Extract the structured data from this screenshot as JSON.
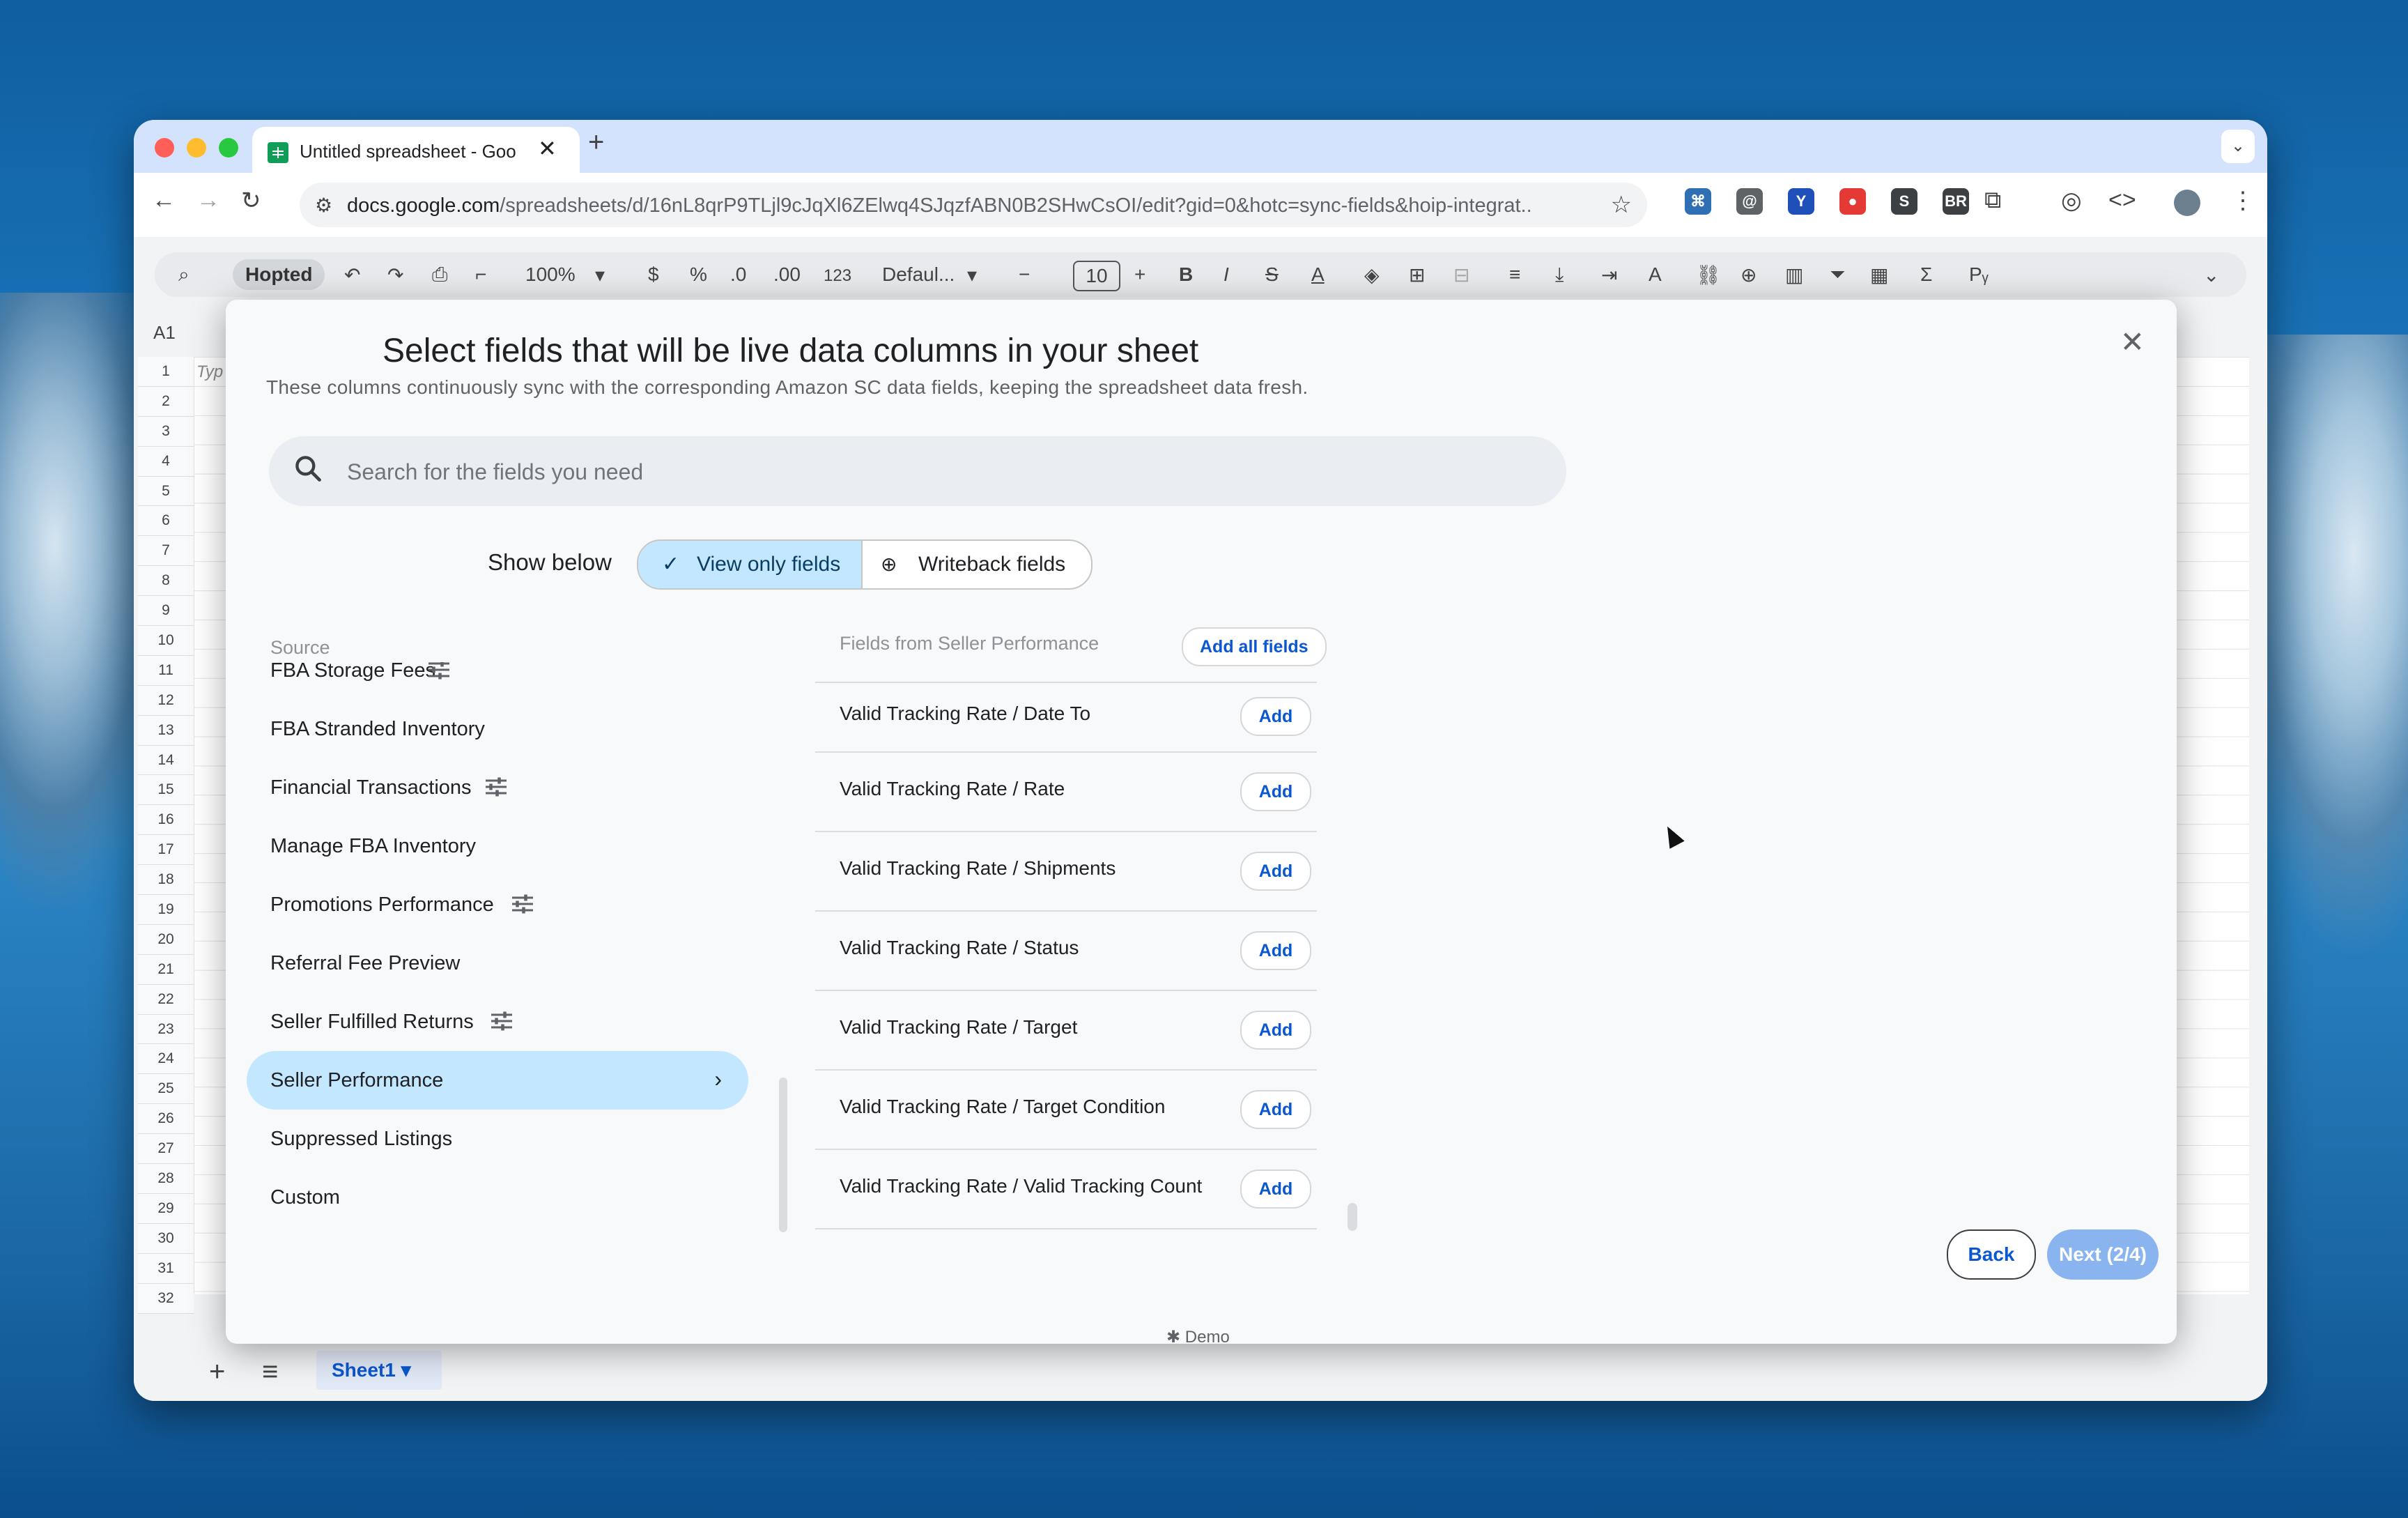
{
  "browser": {
    "tab_title": "Untitled spreadsheet - Googl",
    "tab_close": "✕",
    "new_tab": "+",
    "url_host": "docs.google.com",
    "url_path": "/spreadsheets/d/16nL8qrP9TLjl9cJqXl6ZElwq4SJqzfABN0B2SHwCsOI/edit?gid=0&hotc=sync-fields&hoip-integrat...",
    "extensions": [
      {
        "name": "ext-1",
        "label": "⌘",
        "color": "#2f6fb3"
      },
      {
        "name": "ext-2",
        "label": "@",
        "color": "#5f6368"
      },
      {
        "name": "ext-3",
        "label": "Y",
        "color": "#1f4fb8"
      },
      {
        "name": "ext-4",
        "label": "●",
        "color": "#e53935"
      },
      {
        "name": "ext-5",
        "label": "S",
        "color": "#3c4043"
      },
      {
        "name": "ext-6",
        "label": "BR",
        "color": "#3c4043"
      }
    ]
  },
  "sheets": {
    "toolbar": {
      "hopted": "Hopted",
      "zoom": "100%",
      "currency": "$",
      "percent": "%",
      "dec_less": ".0",
      "dec_more": ".00",
      "number_format": "123",
      "font": "Defaul...",
      "font_size": "10",
      "bold": "B",
      "italic": "I",
      "sigma": "Σ"
    },
    "name_box": "A1",
    "cell_a1": "Typ",
    "row_numbers": [
      "1",
      "2",
      "3",
      "4",
      "5",
      "6",
      "7",
      "8",
      "9",
      "10",
      "11",
      "12",
      "13",
      "14",
      "15",
      "16",
      "17",
      "18",
      "19",
      "20",
      "21",
      "22",
      "23",
      "24",
      "25",
      "26",
      "27",
      "28",
      "29",
      "30",
      "31",
      "32"
    ],
    "sheet_tab": "Sheet1"
  },
  "modal": {
    "title": "Select fields that will be live data columns in your sheet",
    "subtitle": "These columns continuously sync with the corresponding Amazon SC data fields, keeping the spreadsheet data fresh.",
    "search_placeholder": "Search for the fields you need",
    "show_below_label": "Show below",
    "view_only_label": "View only fields",
    "writeback_label": "Writeback fields",
    "source_header": "Source",
    "fields_header": "Fields from Seller Performance",
    "add_all_label": "Add all fields",
    "sources": [
      {
        "label": "FBA Storage Fees",
        "tune": true
      },
      {
        "label": "FBA Stranded Inventory",
        "tune": false
      },
      {
        "label": "Financial Transactions",
        "tune": true
      },
      {
        "label": "Manage FBA Inventory",
        "tune": false
      },
      {
        "label": "Promotions Performance",
        "tune": true
      },
      {
        "label": "Referral Fee Preview",
        "tune": false
      },
      {
        "label": "Seller Fulfilled Returns",
        "tune": true
      },
      {
        "label": "Seller Performance",
        "tune": false,
        "active": true
      },
      {
        "label": "Suppressed Listings",
        "tune": false
      },
      {
        "label": "Custom",
        "tune": false
      }
    ],
    "fields": [
      "Valid Tracking Rate / Date To",
      "Valid Tracking Rate / Rate",
      "Valid Tracking Rate / Shipments",
      "Valid Tracking Rate / Status",
      "Valid Tracking Rate / Target",
      "Valid Tracking Rate / Target Condition",
      "Valid Tracking Rate / Valid Tracking Count"
    ],
    "add_label": "Add",
    "back_label": "Back",
    "next_label": "Next (2/4)",
    "demo_label": "Demo"
  }
}
